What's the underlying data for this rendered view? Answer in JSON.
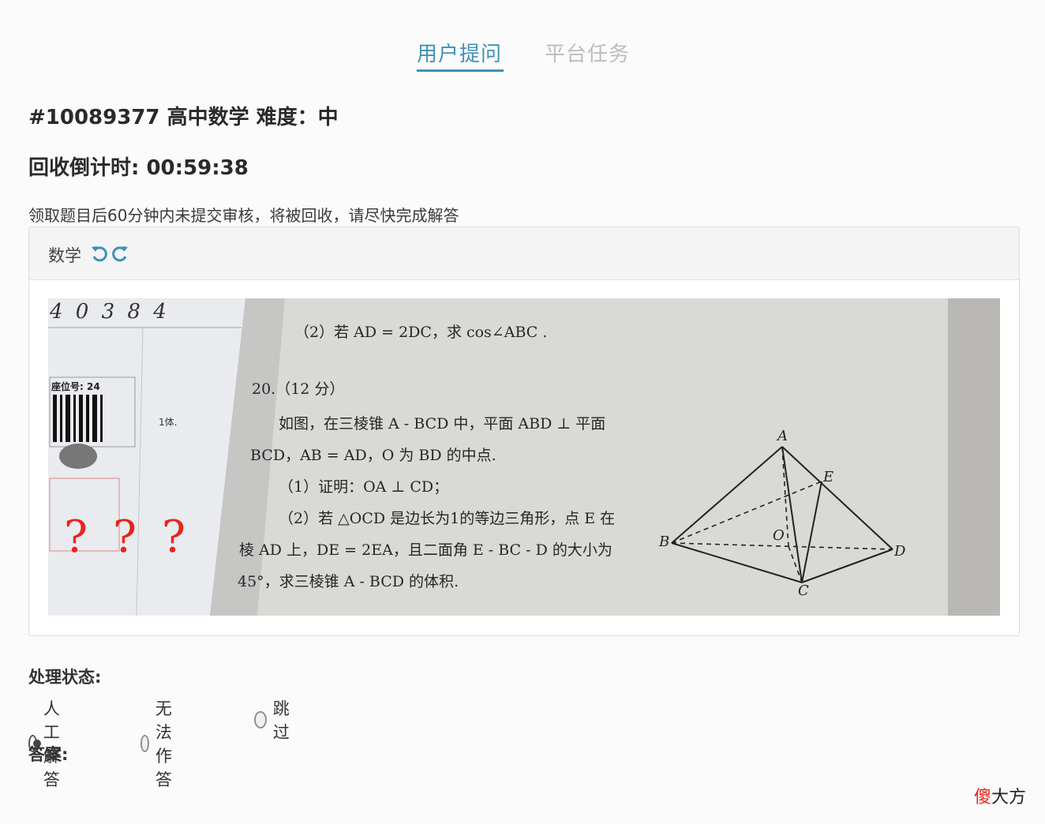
{
  "tabs": [
    {
      "label": "用户提问",
      "active": true
    },
    {
      "label": "平台任务",
      "active": false
    }
  ],
  "question": {
    "title": "#10089377 高中数学 难度：中",
    "countdown": "回收倒计时: 00:59:38",
    "notice": "领取题目后60分钟内未提交审核，将被回收，请尽快完成解答"
  },
  "card": {
    "subject": "数学",
    "icons": [
      "rotate-left-icon",
      "rotate-right-icon"
    ]
  },
  "photo": {
    "handwritten_number": "4 0 3 8 4",
    "seat_label": "座位号: 24",
    "side_label": "1体.",
    "question_marks": [
      "?",
      "?",
      "?"
    ],
    "lines": [
      "（2）若 AD = 2DC，求 cos∠ABC .",
      "20.（12 分）",
      "如图，在三棱锥 A - BCD 中，平面 ABD ⊥ 平面",
      "BCD，AB = AD，O 为 BD 的中点.",
      "（1）证明：OA ⊥ CD；",
      "（2）若 △OCD 是边长为1的等边三角形，点 E 在",
      "棱 AD 上，DE = 2EA，且二面角 E - BC - D 的大小为",
      "45°，求三棱锥 A - BCD 的体积."
    ],
    "figure_labels": {
      "A": "A",
      "B": "B",
      "C": "C",
      "D": "D",
      "E": "E",
      "O": "O"
    }
  },
  "status": {
    "label": "处理状态:",
    "options": [
      {
        "label": "人工解答",
        "checked": true
      },
      {
        "label": "无法作答",
        "checked": false
      },
      {
        "label": "跳过",
        "checked": false
      }
    ]
  },
  "answer_label": "答案:",
  "watermark": {
    "red": "傻",
    "black": "大方"
  },
  "colors": {
    "accent": "#3e91b7",
    "inactive_tab": "#bdbdbd",
    "question_mark": "#e8241c"
  }
}
